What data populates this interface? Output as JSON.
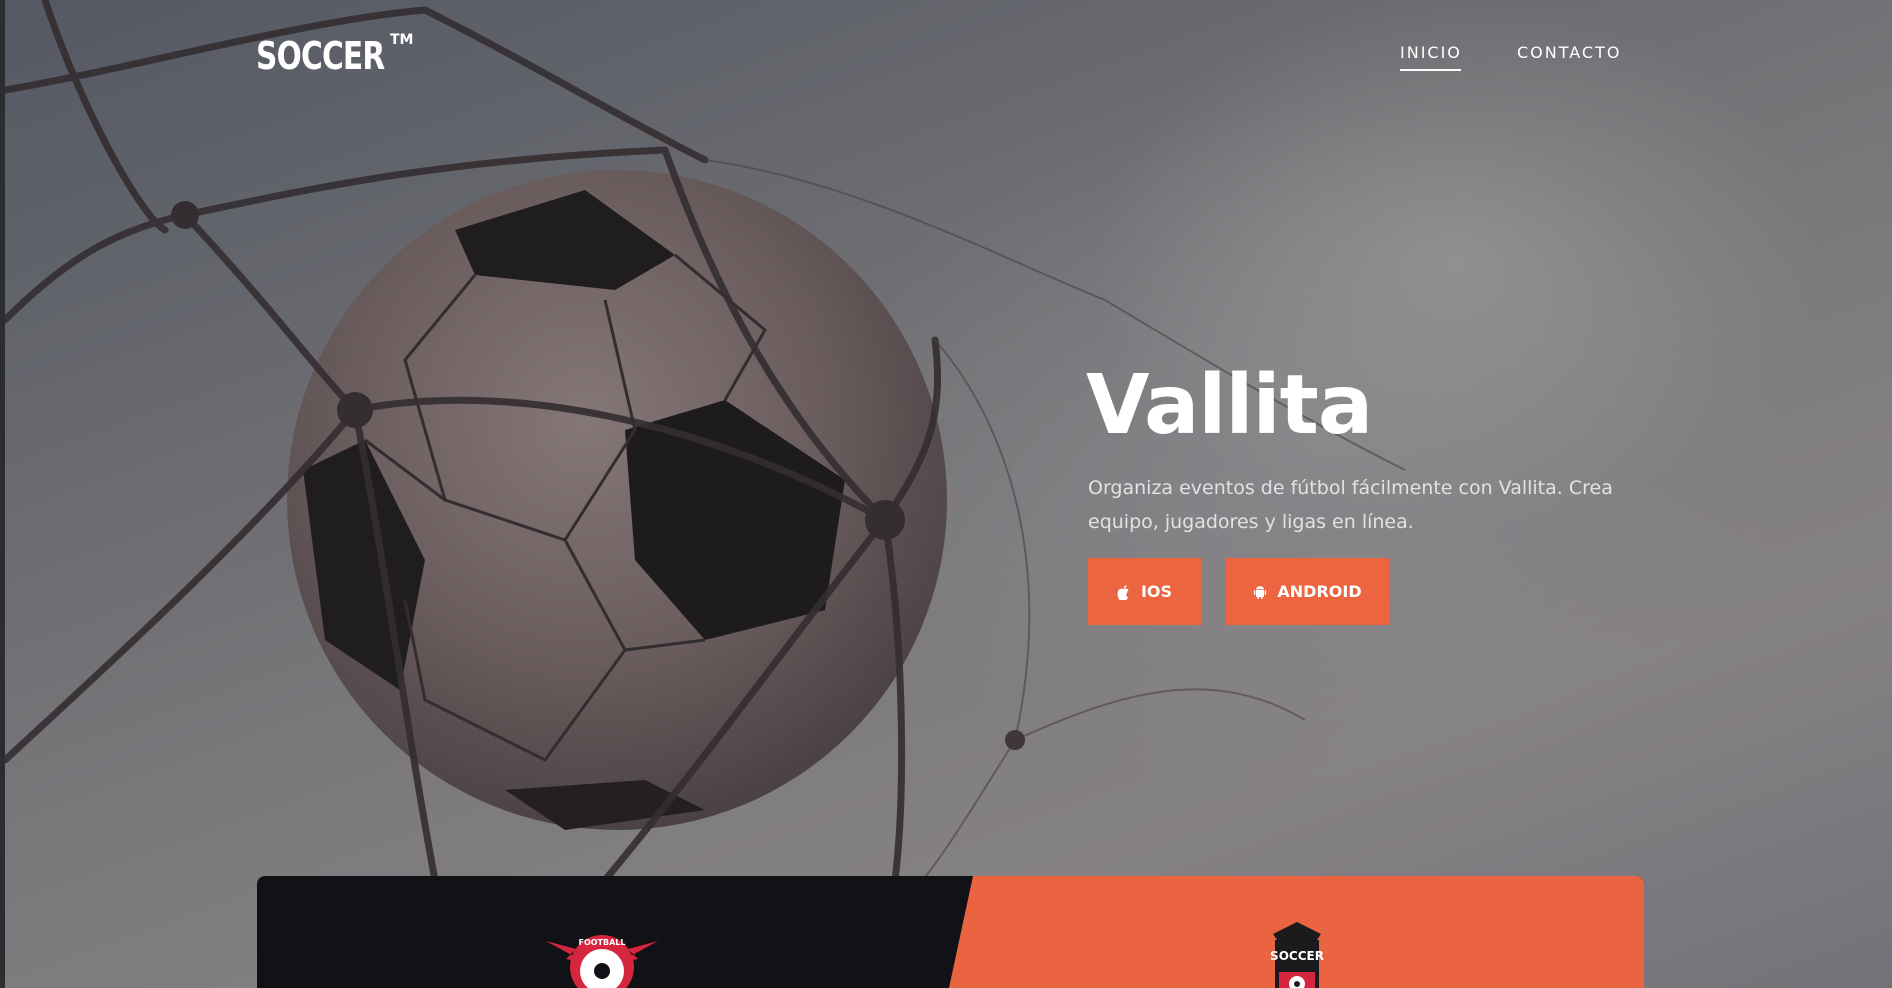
{
  "brand": {
    "logo": "SOCCER",
    "trademark": "TM"
  },
  "nav": {
    "items": [
      {
        "label": "INICIO",
        "active": true
      },
      {
        "label": "CONTACTO",
        "active": false
      }
    ]
  },
  "hero": {
    "title": "Vallita",
    "description": "Organiza eventos de fútbol fácilmente con Vallita. Crea equipo, jugadores y ligas en línea.",
    "buttons": [
      {
        "label": "IOS",
        "icon": "apple-icon"
      },
      {
        "label": "ANDROID",
        "icon": "android-icon"
      }
    ]
  },
  "badges": {
    "left_text": "FOOTBALL",
    "right_text": "SOCCER"
  },
  "colors": {
    "accent": "#ec6540",
    "dark_panel": "#111216",
    "text": "#ffffff"
  }
}
